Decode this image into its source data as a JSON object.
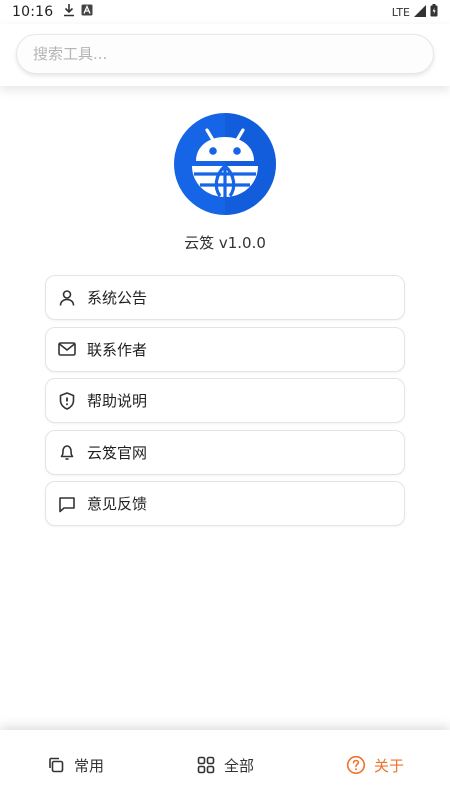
{
  "status_bar": {
    "time": "10:16",
    "network": "LTE",
    "icons": [
      "download-icon",
      "notification-a-icon",
      "signal-icon",
      "battery-icon"
    ]
  },
  "search": {
    "placeholder": "搜索工具..."
  },
  "app": {
    "name_version": "云笈 v1.0.0",
    "logo_icon": "android-globe-logo",
    "logo_color": "#1565e6"
  },
  "menu": {
    "items": [
      {
        "label": "系统公告",
        "icon": "user-icon"
      },
      {
        "label": "联系作者",
        "icon": "mail-icon"
      },
      {
        "label": "帮助说明",
        "icon": "shield-alert-icon"
      },
      {
        "label": "云笈官网",
        "icon": "bell-icon"
      },
      {
        "label": "意见反馈",
        "icon": "message-square-icon"
      }
    ]
  },
  "bottom_nav": {
    "items": [
      {
        "label": "常用",
        "icon": "copy-icon",
        "active": false
      },
      {
        "label": "全部",
        "icon": "grid-icon",
        "active": false
      },
      {
        "label": "关于",
        "icon": "help-circle-icon",
        "active": true
      }
    ],
    "active_color": "#f0712a"
  }
}
